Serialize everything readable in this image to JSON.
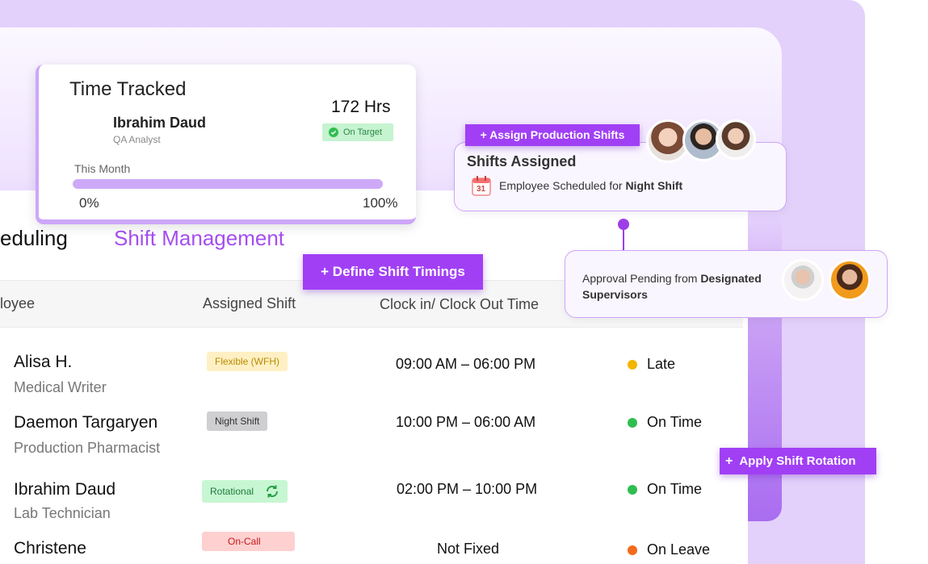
{
  "time_card": {
    "title": "Time Tracked",
    "employee_name": "Ibrahim Daud",
    "employee_role": "QA Analyst",
    "hours": "172 Hrs",
    "badge": "On Target",
    "period_label": "This Month",
    "progress_fraction": 1.0,
    "progress_min": "0%",
    "progress_max": "100%"
  },
  "shifts_card": {
    "action_button": "+ Assign Production Shifts",
    "title": "Shifts Assigned",
    "message_prefix": "Employee Scheduled for ",
    "message_bold": "Night Shift",
    "calendar_day": "31"
  },
  "approval_card": {
    "message_prefix": "Approval Pending from ",
    "message_bold": "Designated Supervisors"
  },
  "section": {
    "title": "eduling",
    "subtitle": "Shift Management"
  },
  "buttons": {
    "define": "+ Define Shift Timings",
    "rotation_plus": "+",
    "rotation": "Apply Shift Rotation"
  },
  "table": {
    "headers": [
      "loyee",
      "Assigned Shift",
      "Clock in/ Clock Out Time"
    ],
    "rows": [
      {
        "name": "Alisa H.",
        "role": "Medical Writer",
        "shift": "Flexible (WFH)",
        "time": "09:00 AM – 06:00 PM",
        "status": "Late"
      },
      {
        "name": "Daemon Targaryen",
        "role": "Production Pharmacist",
        "shift": "Night Shift",
        "time": "10:00 PM – 06:00 AM",
        "status": "On Time"
      },
      {
        "name": "Ibrahim Daud",
        "role": "Lab Technician",
        "shift": "Rotational",
        "time": "02:00 PM – 10:00 PM",
        "status": "On Time"
      },
      {
        "name": "Christene",
        "role": "",
        "shift": "On-Call",
        "time": "Not Fixed",
        "status": "On Leave"
      }
    ]
  },
  "colors": {
    "accent": "#a13ff5",
    "late": "#f2b500",
    "on_time": "#2fbe4f",
    "on_leave": "#f26a1b"
  }
}
